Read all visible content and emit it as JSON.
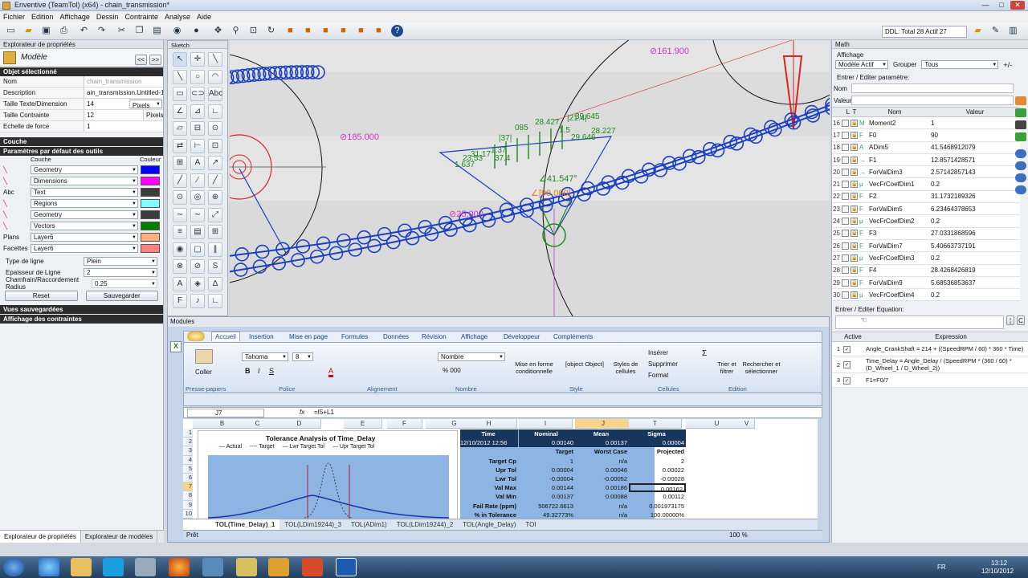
{
  "window": {
    "title": "Enventive (TeamTol) (x64) - chain_transmission*",
    "min": "—",
    "max": "□",
    "close": "✕"
  },
  "menu": [
    "Fichier",
    "Edition",
    "Affichage",
    "Dessin",
    "Contrainte",
    "Analyse",
    "Aide"
  ],
  "toolbar": {
    "ddl_status": "DDL: Total 28 Actif 27"
  },
  "props": {
    "panel_title": "Explorateur de propriétés",
    "header": "Modèle",
    "section_selected": "Objet sélectionné",
    "rows": [
      {
        "k": "Nom",
        "v": "chain_transmission"
      },
      {
        "k": "Description",
        "v": "ain_transmission.Untitled-1>"
      },
      {
        "k": "Taille Texte/Dimension",
        "v": "14",
        "unit": "Pixels"
      },
      {
        "k": "Taille Contrainte",
        "v": "12",
        "unit": "Pixels"
      },
      {
        "k": "Echelle de force",
        "v": "1"
      }
    ],
    "section_layer": "Couche",
    "section_defaults": "Paramètres par défaut des outils",
    "col_layer": "Couche",
    "col_color": "Couleur",
    "tool_rows": [
      {
        "icon": "line-tool-icon",
        "layer": "Geometry",
        "color": "#0000ff"
      },
      {
        "icon": "dimension-tool-icon",
        "layer": "Dimensions",
        "color": "#ff00ff"
      },
      {
        "icon": "text-tool-icon",
        "lab": "Abc",
        "layer": "Text",
        "color": "#3c3c3c"
      },
      {
        "icon": "region-tool-icon",
        "layer": "Regions",
        "color": "#80ffff"
      },
      {
        "icon": "geometry-tool-icon",
        "layer": "Geometry",
        "color": "#3c3c3c"
      },
      {
        "icon": "vector-tool-icon",
        "layer": "Vectors",
        "color": "#008000"
      },
      {
        "lab": "Plans",
        "layer": "Layer6",
        "color": "#ffb080"
      },
      {
        "lab": "Facettes",
        "layer": "Layer6",
        "color": "#ff8080"
      }
    ],
    "linetype_label": "Type de ligne",
    "linetype": "Plein",
    "thickness_label": "Epaisseur de Ligne",
    "thickness": "2",
    "chamfer_label": "Chamfrain/Raccordement Radius",
    "chamfer": "0.25",
    "reset": "Reset",
    "save": "Sauvegarder",
    "saved_views": "Vues sauvegardées",
    "constraints_display": "Affichage des contraintes",
    "bottom_tabs": [
      "Explorateur de propriétés",
      "Explorateur de modèles"
    ]
  },
  "sketch": {
    "title": "Sketch",
    "tools": [
      "↖",
      "✛",
      "╲",
      "╲",
      "○",
      "◠",
      "▭",
      "⊂⊃",
      "Abc",
      "∠",
      "⊿",
      "∟",
      "▱",
      "⊟",
      "⊙",
      "⇄",
      "⊢",
      "⊡",
      "⊞",
      "A",
      "↗",
      "╱",
      "∕",
      "╱",
      "⊙",
      "◎",
      "⊕",
      "∼",
      "∼",
      "⤢",
      "≡",
      "▤",
      "⊞",
      "◉",
      "▢",
      "∥",
      "⊗",
      "⊘",
      "S",
      "A",
      "◈",
      "∆",
      "F",
      "♪",
      "∟"
    ]
  },
  "drawing": {
    "dims": [
      "⊘161.900",
      "⊘185.000",
      "⊘25.000",
      "∠41.547°",
      "∠[90.000]"
    ],
    "small": [
      "085",
      "|37|",
      "1.37",
      "28.427",
      "1.5",
      "|21.4|",
      "23.53",
      "31.17",
      "1.637",
      "37.4",
      "39.645",
      "29.646",
      "28.227"
    ]
  },
  "math": {
    "title": "Math",
    "display_label": "Affichage",
    "display_value": "Modèle Actif",
    "group_label": "Grouper",
    "group_value": "Tous",
    "param_label": "Entrer / Editer paramètre:",
    "name_label": "Nom",
    "value_label": "Valeur",
    "col_l": "L",
    "col_t": "T",
    "col_name": "Nom",
    "col_value": "Valeur",
    "rows": [
      {
        "n": "16",
        "t": "M",
        "nm": "Moment2",
        "v": "1"
      },
      {
        "n": "17",
        "t": "F",
        "nm": "F0",
        "v": "90"
      },
      {
        "n": "18",
        "t": "A",
        "nm": "ADim5",
        "v": "41.5468912079"
      },
      {
        "n": "19",
        "t": "→",
        "nm": "F1",
        "v": "12.8571428571"
      },
      {
        "n": "20",
        "t": "→",
        "nm": "ForValDim3",
        "v": "2.57142857143"
      },
      {
        "n": "21",
        "t": "μ",
        "nm": "VecFrCoefDim1",
        "v": "0.2"
      },
      {
        "n": "22",
        "t": "F",
        "nm": "F2",
        "v": "31.1732189326"
      },
      {
        "n": "23",
        "t": "F",
        "nm": "ForValDim5",
        "v": "6.23464378653"
      },
      {
        "n": "24",
        "t": "μ",
        "nm": "VecFrCoefDim2",
        "v": "0.2"
      },
      {
        "n": "25",
        "t": "F",
        "nm": "F3",
        "v": "27.0331868596"
      },
      {
        "n": "26",
        "t": "F",
        "nm": "ForValDim7",
        "v": "5.40663737191"
      },
      {
        "n": "27",
        "t": "μ",
        "nm": "VecFrCoefDim3",
        "v": "0.2"
      },
      {
        "n": "28",
        "t": "F",
        "nm": "F4",
        "v": "28.4268426819"
      },
      {
        "n": "29",
        "t": "F",
        "nm": "ForValDim9",
        "v": "5.68536853637"
      },
      {
        "n": "30",
        "t": "μ",
        "nm": "VecFrCoefDim4",
        "v": "0.2"
      }
    ],
    "eq_label": "Entrer / Editer Equation:",
    "eq_col_active": "Active",
    "eq_col_expr": "Expression",
    "equations": [
      {
        "n": "1",
        "e": "Angle_CrankShaft = 214 + ((SpeedRPM / 60) * 360 * Time)"
      },
      {
        "n": "2",
        "e": "Time_Delay = Angle_Delay / (SpeedRPM * (360 / 60) * (D_Wheel_1 / D_Wheel_2))"
      },
      {
        "n": "3",
        "e": "F1=F0/7"
      }
    ]
  },
  "modules": {
    "title": "Modules",
    "tabs": [
      "Accueil",
      "Insertion",
      "Mise en page",
      "Formules",
      "Données",
      "Révision",
      "Affichage",
      "Développeur",
      "Compléments"
    ],
    "groups": [
      "Presse-papiers",
      "Police",
      "Alignement",
      "Nombre",
      "Style",
      "Cellules",
      "Edition"
    ],
    "paste": "Coller",
    "font": "Tahoma",
    "size": "8",
    "numfmt": "Nombre",
    "cond": "Mise en forme conditionnelle",
    "table": {
      "hdr": [
        "Time",
        "Nominal",
        "Mean",
        "Sigma"
      ],
      "r2": [
        "12/10/2012 12:56",
        "0.00140",
        "0.00137",
        "0.00004"
      ],
      "hdr2": [
        "",
        "Target",
        "Worst Case",
        "Projected"
      ],
      "rows": [
        [
          "Target Cp",
          "1",
          "n/a",
          "2"
        ],
        [
          "Upr Tol",
          "0.00004",
          "0.00046",
          "0.00022"
        ],
        [
          "Lwr Tol",
          "-0.00004",
          "-0.00052",
          "-0.00028"
        ],
        [
          "Val Max",
          "0.00144",
          "0.00186",
          "0.00162"
        ],
        [
          "Val Min",
          "0.00137",
          "0.00088",
          "0.00112"
        ],
        [
          "Fail Rate (ppm)",
          "506722.6613",
          "n/a",
          "0.001973175"
        ],
        [
          "% in Tolerance",
          "49.32773%",
          "n/a",
          "100.00000%"
        ]
      ]
    },
    "styles": "Styles de cellules",
    "ins": "Insérer",
    "del": "Supprimer",
    "fmt": "Format",
    "sort": "Trier et filtrer",
    "find": "Rechercher et sélectionner",
    "cellref": "J7",
    "formula": "=I5+L1",
    "cols": [
      "A",
      "B",
      "C",
      "D",
      "E",
      "F",
      "G",
      "H",
      "I",
      "J",
      "T",
      "U",
      "V"
    ],
    "sheet_rows": [
      "1",
      "2",
      "3",
      "4",
      "5",
      "6",
      "7",
      "8",
      "9",
      "10"
    ],
    "chart_title": "Tolerance Analysis of Time_Delay",
    "legend": [
      "Actual",
      "Target",
      "Lwr Target Tol",
      "Upr Target Tol"
    ],
    "sheet_tabs": [
      "TOL(Time_Delay)_1",
      "TOL(LDim19244)_3",
      "TOL(ADim1)",
      "TOL(LDim19244)_2",
      "TOL(Angle_Delay)",
      "TOI"
    ],
    "status": "Prêt",
    "zoom": "100 %"
  },
  "taskbar": {
    "lang": "FR",
    "time": "13:12",
    "date": "12/10/2012"
  }
}
